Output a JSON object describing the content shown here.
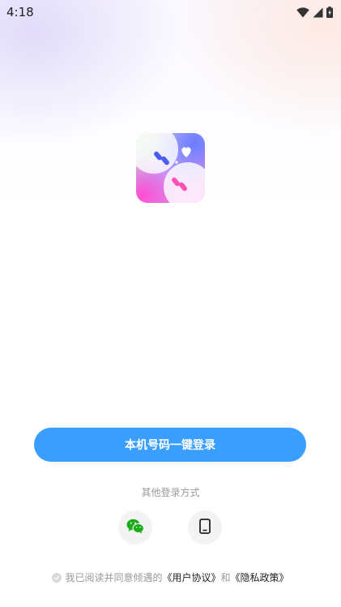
{
  "status_bar": {
    "time": "4:18",
    "icons": [
      "wifi-icon",
      "signal-icon",
      "battery-icon"
    ]
  },
  "logo": {
    "icon": "app-logo-icon"
  },
  "login": {
    "one_click_label": "本机号码一键登录"
  },
  "other_methods": {
    "label": "其他登录方式",
    "options": [
      {
        "icon": "wechat-icon"
      },
      {
        "icon": "phone-icon"
      }
    ]
  },
  "agreement": {
    "prefix": "我已阅读并同意倾遇的",
    "user_agreement": "《用户协议》",
    "conjunction": "和",
    "privacy_policy": "《隐私政策》"
  },
  "colors": {
    "primary": "#3a9efe",
    "wechat": "#1aad19",
    "muted_text": "#999999"
  }
}
